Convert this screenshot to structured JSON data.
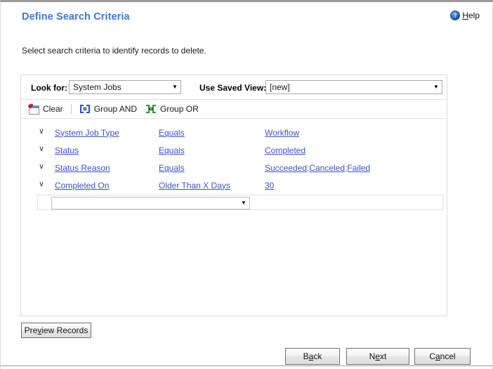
{
  "header": {
    "title": "Define Search Criteria",
    "help_label": "Help",
    "help_accesskey": "H",
    "help_icon": "question-circle-icon"
  },
  "instruction": "Select search criteria to identify records to delete.",
  "criteria_panel": {
    "look_for": {
      "label": "Look for:",
      "value": "System Jobs",
      "arrow_glyph": "▼"
    },
    "saved_view": {
      "label": "Use Saved View:",
      "value": "[new]",
      "arrow_glyph": "▼"
    },
    "toolbar": [
      {
        "label": "Clear",
        "icon": "clear-icon"
      },
      {
        "label": "Group AND",
        "icon": "group-and-icon"
      },
      {
        "label": "Group OR",
        "icon": "group-or-icon"
      }
    ],
    "rows": [
      {
        "chevron": "∨",
        "field": "System Job Type",
        "operator": "Equals",
        "value": "Workflow"
      },
      {
        "chevron": "∨",
        "field": "Status",
        "operator": "Equals",
        "value": "Completed"
      },
      {
        "chevron": "∨",
        "field": "Status Reason",
        "operator": "Equals",
        "value": "Succeeded;Canceled;Failed"
      },
      {
        "chevron": "∨",
        "field": "Completed On",
        "operator": "Older Than X Days",
        "value": "30"
      }
    ],
    "new_row": {
      "value": "",
      "placeholder": "",
      "arrow_glyph": "▼"
    }
  },
  "buttons": {
    "preview": {
      "pre": "Pre",
      "key": "v",
      "post": "iew Records"
    },
    "back": {
      "pre": "B",
      "key": "a",
      "post": "ck"
    },
    "next": {
      "pre": "N",
      "key": "e",
      "post": "xt"
    },
    "cancel": {
      "pre": "C",
      "key": "a",
      "post": "ncel"
    }
  },
  "statusbar": {
    "left": "",
    "middle": "",
    "right": ""
  },
  "colors": {
    "title": "#3b78d8",
    "link": "#3a53c8",
    "panel_border": "#dcdcdc",
    "group_and": "#2a4fd0",
    "group_or": "#1f9d34",
    "clear_red": "#dd2020"
  }
}
